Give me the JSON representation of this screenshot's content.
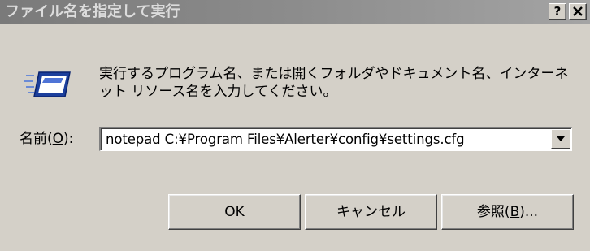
{
  "window": {
    "title": "ファイル名を指定して実行",
    "help_label": "?",
    "close_label": "✕"
  },
  "description": {
    "line1": "実行するプログラム名、または開くフォルダやドキュメント名、インターネ",
    "line2": "ット リソース名を入力してください。"
  },
  "name_field": {
    "label_prefix": "名前(",
    "label_accel": "O",
    "label_suffix": "):",
    "value": "notepad C:¥Program Files¥Alerter¥config¥settings.cfg"
  },
  "buttons": {
    "ok": "OK",
    "cancel": "キャンセル",
    "browse_prefix": "参照(",
    "browse_accel": "B",
    "browse_suffix": ")..."
  },
  "icons": {
    "run": "run-dialog-icon",
    "dropdown": "chevron-down-icon"
  }
}
